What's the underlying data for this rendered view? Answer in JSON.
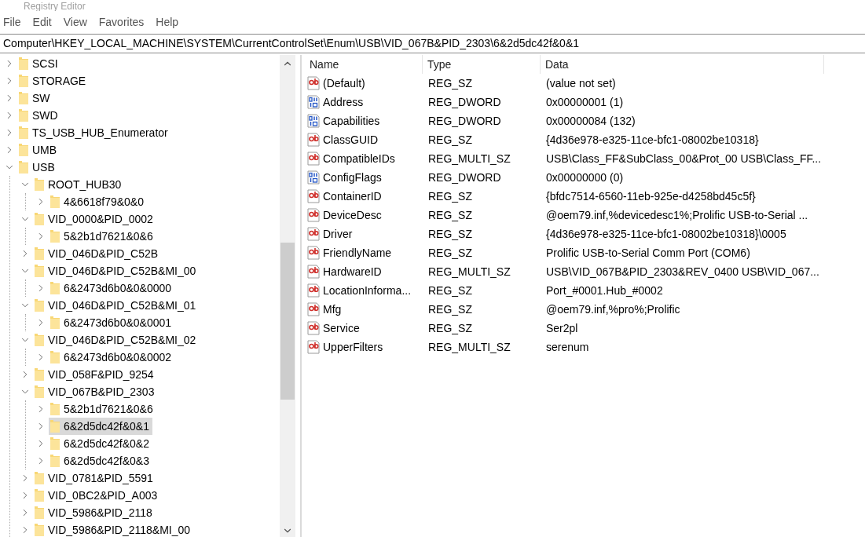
{
  "window": {
    "title": "Registry Editor"
  },
  "menu": [
    "File",
    "Edit",
    "View",
    "Favorites",
    "Help"
  ],
  "address": "Computer\\HKEY_LOCAL_MACHINE\\SYSTEM\\CurrentControlSet\\Enum\\USB\\VID_067B&PID_2303\\6&2d5dc42f&0&1",
  "tree": [
    {
      "label": "SCSI",
      "expanded": false,
      "selected": false
    },
    {
      "label": "STORAGE",
      "expanded": false,
      "selected": false
    },
    {
      "label": "SW",
      "expanded": false,
      "selected": false
    },
    {
      "label": "SWD",
      "expanded": false,
      "selected": false
    },
    {
      "label": "TS_USB_HUB_Enumerator",
      "expanded": false,
      "selected": false
    },
    {
      "label": "UMB",
      "expanded": false,
      "selected": false
    },
    {
      "label": "USB",
      "expanded": true,
      "selected": false,
      "children": [
        {
          "label": "ROOT_HUB30",
          "expanded": true,
          "selected": false,
          "children": [
            {
              "label": "4&6618f79&0&0",
              "expanded": false,
              "selected": false
            }
          ]
        },
        {
          "label": "VID_0000&PID_0002",
          "expanded": true,
          "selected": false,
          "children": [
            {
              "label": "5&2b1d7621&0&6",
              "expanded": false,
              "selected": false
            }
          ]
        },
        {
          "label": "VID_046D&PID_C52B",
          "expanded": false,
          "selected": false
        },
        {
          "label": "VID_046D&PID_C52B&MI_00",
          "expanded": true,
          "selected": false,
          "children": [
            {
              "label": "6&2473d6b0&0&0000",
              "expanded": false,
              "selected": false
            }
          ]
        },
        {
          "label": "VID_046D&PID_C52B&MI_01",
          "expanded": true,
          "selected": false,
          "children": [
            {
              "label": "6&2473d6b0&0&0001",
              "expanded": false,
              "selected": false
            }
          ]
        },
        {
          "label": "VID_046D&PID_C52B&MI_02",
          "expanded": true,
          "selected": false,
          "children": [
            {
              "label": "6&2473d6b0&0&0002",
              "expanded": false,
              "selected": false
            }
          ]
        },
        {
          "label": "VID_058F&PID_9254",
          "expanded": false,
          "selected": false
        },
        {
          "label": "VID_067B&PID_2303",
          "expanded": true,
          "selected": false,
          "children": [
            {
              "label": "5&2b1d7621&0&6",
              "expanded": false,
              "selected": false
            },
            {
              "label": "6&2d5dc42f&0&1",
              "expanded": false,
              "selected": true
            },
            {
              "label": "6&2d5dc42f&0&2",
              "expanded": false,
              "selected": false
            },
            {
              "label": "6&2d5dc42f&0&3",
              "expanded": false,
              "selected": false
            }
          ]
        },
        {
          "label": "VID_0781&PID_5591",
          "expanded": false,
          "selected": false
        },
        {
          "label": "VID_0BC2&PID_A003",
          "expanded": false,
          "selected": false
        },
        {
          "label": "VID_5986&PID_2118",
          "expanded": false,
          "selected": false
        },
        {
          "label": "VID_5986&PID_2118&MI_00",
          "expanded": false,
          "selected": false
        }
      ]
    }
  ],
  "columns": [
    "Name",
    "Type",
    "Data"
  ],
  "values": [
    {
      "kind": "string",
      "name": "(Default)",
      "type": "REG_SZ",
      "data": "(value not set)"
    },
    {
      "kind": "binary",
      "name": "Address",
      "type": "REG_DWORD",
      "data": "0x00000001 (1)"
    },
    {
      "kind": "binary",
      "name": "Capabilities",
      "type": "REG_DWORD",
      "data": "0x00000084 (132)"
    },
    {
      "kind": "string",
      "name": "ClassGUID",
      "type": "REG_SZ",
      "data": "{4d36e978-e325-11ce-bfc1-08002be10318}"
    },
    {
      "kind": "string",
      "name": "CompatibleIDs",
      "type": "REG_MULTI_SZ",
      "data": "USB\\Class_FF&SubClass_00&Prot_00 USB\\Class_FF..."
    },
    {
      "kind": "binary",
      "name": "ConfigFlags",
      "type": "REG_DWORD",
      "data": "0x00000000 (0)"
    },
    {
      "kind": "string",
      "name": "ContainerID",
      "type": "REG_SZ",
      "data": "{bfdc7514-6560-11eb-925e-d4258bd45c5f}"
    },
    {
      "kind": "string",
      "name": "DeviceDesc",
      "type": "REG_SZ",
      "data": "@oem79.inf,%devicedesc1%;Prolific USB-to-Serial ..."
    },
    {
      "kind": "string",
      "name": "Driver",
      "type": "REG_SZ",
      "data": "{4d36e978-e325-11ce-bfc1-08002be10318}\\0005"
    },
    {
      "kind": "string",
      "name": "FriendlyName",
      "type": "REG_SZ",
      "data": "Prolific USB-to-Serial Comm Port (COM6)"
    },
    {
      "kind": "string",
      "name": "HardwareID",
      "type": "REG_MULTI_SZ",
      "data": "USB\\VID_067B&PID_2303&REV_0400 USB\\VID_067..."
    },
    {
      "kind": "string",
      "name": "LocationInforma...",
      "type": "REG_SZ",
      "data": "Port_#0001.Hub_#0002"
    },
    {
      "kind": "string",
      "name": "Mfg",
      "type": "REG_SZ",
      "data": "@oem79.inf,%pro%;Prolific"
    },
    {
      "kind": "string",
      "name": "Service",
      "type": "REG_SZ",
      "data": "Ser2pl"
    },
    {
      "kind": "string",
      "name": "UpperFilters",
      "type": "REG_MULTI_SZ",
      "data": "serenum"
    }
  ]
}
